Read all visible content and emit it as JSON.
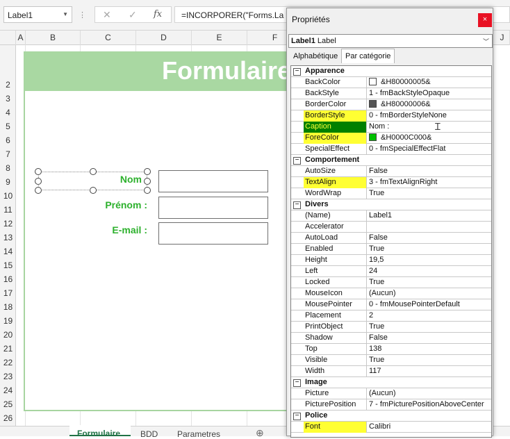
{
  "formula_bar": {
    "name_box": "Label1",
    "cancel_icon": "✕",
    "enter_icon": "✓",
    "fx_icon": "fx",
    "formula": "=INCORPORER(\"Forms.La"
  },
  "columns": [
    "A",
    "B",
    "C",
    "D",
    "E",
    "F",
    "J"
  ],
  "rows": [
    "2",
    "3",
    "4",
    "5",
    "6",
    "7",
    "8",
    "9",
    "10",
    "11",
    "12",
    "13",
    "14",
    "15",
    "16",
    "17",
    "18",
    "19",
    "20",
    "21",
    "22",
    "23",
    "24",
    "25",
    "26"
  ],
  "form": {
    "title": "Formulaire",
    "labels": {
      "nom": "Nom",
      "prenom": "Prénom :",
      "email": "E-mail :"
    }
  },
  "sheet_tabs": {
    "active": "Formulaire",
    "tab2": "BDD",
    "tab3": "Parametres",
    "add_icon": "⊕"
  },
  "properties": {
    "title": "Propriétés",
    "close": "×",
    "object_name": "Label1",
    "object_type": "Label",
    "tabs": {
      "alpha": "Alphabétique",
      "category": "Par catégorie"
    },
    "categories": {
      "apparence": "Apparence",
      "comportement": "Comportement",
      "divers": "Divers",
      "image": "Image",
      "police": "Police"
    },
    "apparence": [
      {
        "name": "BackColor",
        "value": "&H80000005&"
      },
      {
        "name": "BackStyle",
        "value": "1 - fmBackStyleOpaque"
      },
      {
        "name": "BorderColor",
        "value": "&H80000006&"
      },
      {
        "name": "BorderStyle",
        "value": "0 - fmBorderStyleNone"
      },
      {
        "name": "Caption",
        "value": "Nom :"
      },
      {
        "name": "ForeColor",
        "value": "&H0000C000&"
      },
      {
        "name": "SpecialEffect",
        "value": "0 - fmSpecialEffectFlat"
      }
    ],
    "comportement": [
      {
        "name": "AutoSize",
        "value": "False"
      },
      {
        "name": "TextAlign",
        "value": "3 - fmTextAlignRight"
      },
      {
        "name": "WordWrap",
        "value": "True"
      }
    ],
    "divers": [
      {
        "name": "(Name)",
        "value": "Label1"
      },
      {
        "name": "Accelerator",
        "value": ""
      },
      {
        "name": "AutoLoad",
        "value": "False"
      },
      {
        "name": "Enabled",
        "value": "True"
      },
      {
        "name": "Height",
        "value": "19,5"
      },
      {
        "name": "Left",
        "value": "24"
      },
      {
        "name": "Locked",
        "value": "True"
      },
      {
        "name": "MouseIcon",
        "value": "(Aucun)"
      },
      {
        "name": "MousePointer",
        "value": "0 - fmMousePointerDefault"
      },
      {
        "name": "Placement",
        "value": "2"
      },
      {
        "name": "PrintObject",
        "value": "True"
      },
      {
        "name": "Shadow",
        "value": "False"
      },
      {
        "name": "Top",
        "value": "138"
      },
      {
        "name": "Visible",
        "value": "True"
      },
      {
        "name": "Width",
        "value": "117"
      }
    ],
    "image": [
      {
        "name": "Picture",
        "value": "(Aucun)"
      },
      {
        "name": "PicturePosition",
        "value": "7 - fmPicturePositionAboveCenter"
      }
    ],
    "police": [
      {
        "name": "Font",
        "value": "Calibri"
      }
    ],
    "colors": {
      "backcolor": "#ffffff",
      "bordercolor": "#555555",
      "forecolor": "#00c000",
      "highlight": "#ffff33",
      "selected": "#008000"
    }
  }
}
